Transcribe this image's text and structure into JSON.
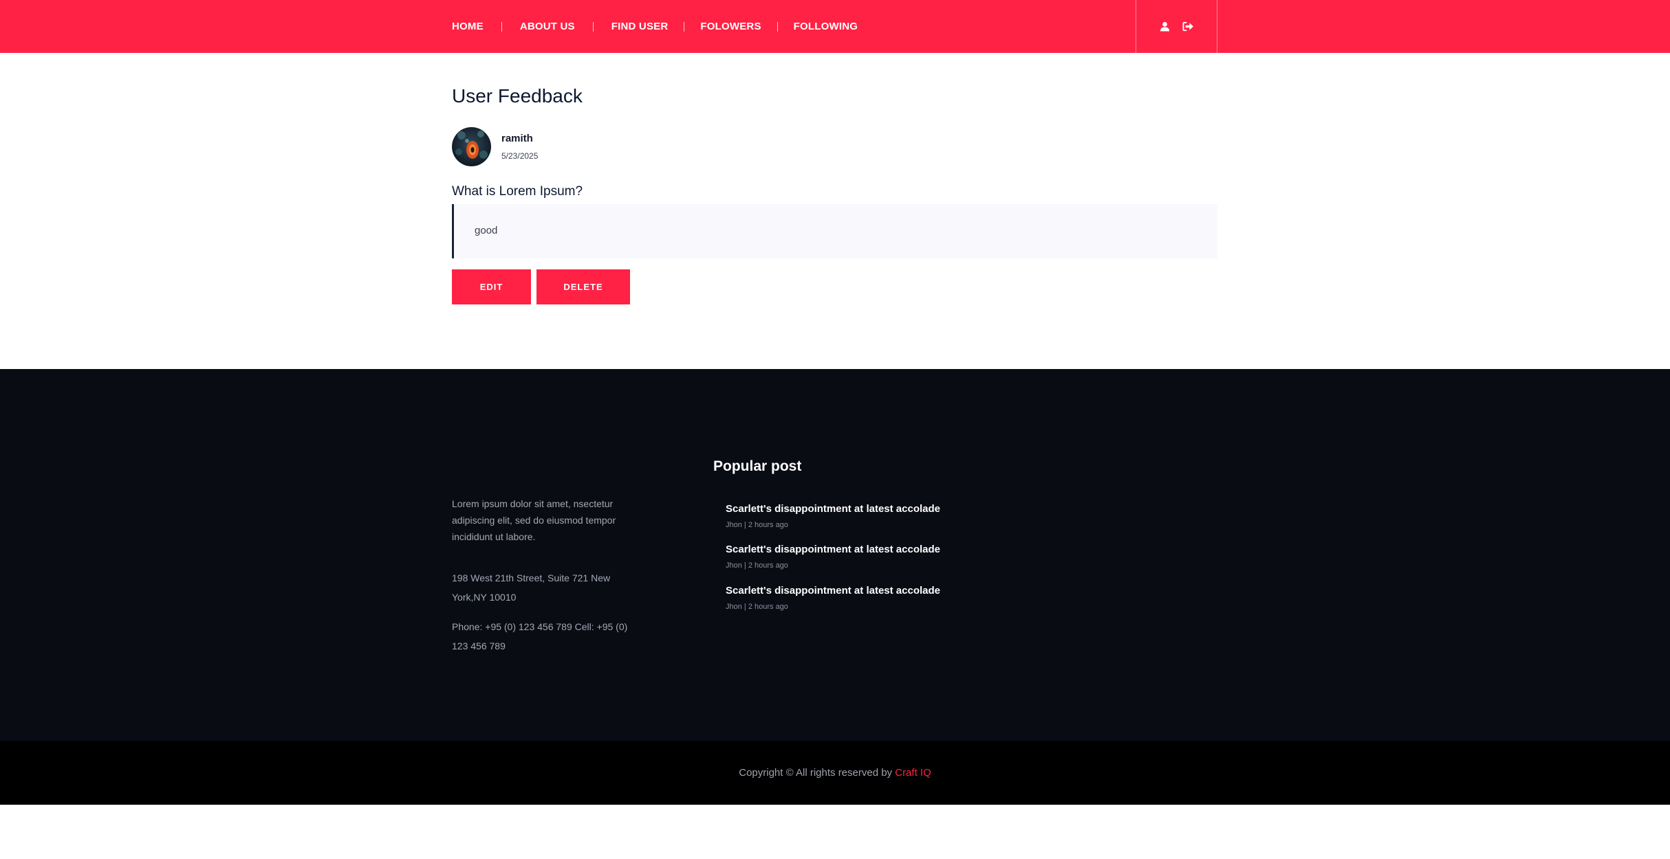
{
  "header": {
    "nav": [
      {
        "label": "HOME"
      },
      {
        "label": "ABOUT US"
      },
      {
        "label": "FIND USER"
      },
      {
        "label": "FOLOWERS"
      },
      {
        "label": "FOLLOWING"
      }
    ],
    "icons": [
      "user-icon",
      "sign-out-icon"
    ],
    "background": "#ff2244"
  },
  "main": {
    "title": "User Feedback",
    "user": {
      "name": "ramith",
      "date": "5/23/2025"
    },
    "question": "What is Lorem Ipsum?",
    "answer": "good",
    "buttons": {
      "edit": "EDIT",
      "delete": "DELETE"
    }
  },
  "footer": {
    "about": "Lorem ipsum dolor sit amet, nsectetur adipiscing elit, sed do eiusmod tempor incididunt ut labore.",
    "address": "198 West 21th Street, Suite 721 New York,NY 10010",
    "phone": "Phone: +95 (0) 123 456 789 Cell: +95 (0) 123 456 789",
    "popular_heading": "Popular post",
    "posts": [
      {
        "title": "Scarlett's disappointment at latest accolade",
        "meta": "Jhon | 2 hours ago"
      },
      {
        "title": "Scarlett's disappointment at latest accolade",
        "meta": "Jhon | 2 hours ago"
      },
      {
        "title": "Scarlett's disappointment at latest accolade",
        "meta": "Jhon | 2 hours ago"
      }
    ],
    "copyright_text": "Copyright © All rights reserved by ",
    "brand": "Craft IQ",
    "background": "#0a0c14"
  },
  "colors": {
    "accent": "#ff2244",
    "dark": "#0a0c14",
    "bottom": "#000000"
  }
}
